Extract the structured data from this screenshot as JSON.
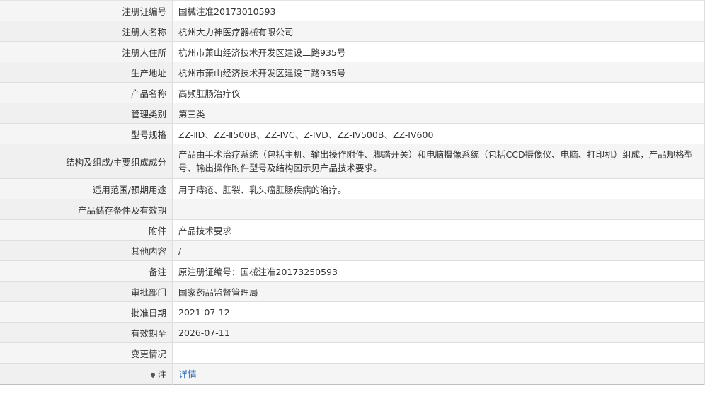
{
  "rows": [
    {
      "label": "注册证编号",
      "value": "国械注准20173010593"
    },
    {
      "label": "注册人名称",
      "value": "杭州大力神医疗器械有限公司"
    },
    {
      "label": "注册人住所",
      "value": "杭州市萧山经济技术开发区建设二路935号"
    },
    {
      "label": "生产地址",
      "value": "杭州市萧山经济技术开发区建设二路935号"
    },
    {
      "label": "产品名称",
      "value": "高频肛肠治疗仪"
    },
    {
      "label": "管理类别",
      "value": "第三类"
    },
    {
      "label": "型号规格",
      "value": "ZZ-ⅡD、ZZ-Ⅱ500B、ZZ-IVC、Z-IVD、ZZ-IV500B、ZZ-IV600"
    },
    {
      "label": "结构及组成/主要组成成分",
      "value": "产品由手术治疗系统（包括主机、输出操作附件、脚踏开关）和电脑摄像系统（包括CCD摄像仪、电脑、打印机）组成，产品规格型号、输出操作附件型号及结构图示见产品技术要求。"
    },
    {
      "label": "适用范围/预期用途",
      "value": "用于痔疮、肛裂、乳头瘤肛肠疾病的治疗。"
    },
    {
      "label": "产品储存条件及有效期",
      "value": ""
    },
    {
      "label": "附件",
      "value": "产品技术要求"
    },
    {
      "label": "其他内容",
      "value": "/"
    },
    {
      "label": "备注",
      "value": "原注册证编号：国械注准20173250593"
    },
    {
      "label": "审批部门",
      "value": "国家药品监督管理局"
    },
    {
      "label": "批准日期",
      "value": "2021-07-12"
    },
    {
      "label": "有效期至",
      "value": "2026-07-11"
    },
    {
      "label": "变更情况",
      "value": ""
    }
  ],
  "note": {
    "label": "注",
    "link_text": "详情",
    "icon": "pin-icon"
  }
}
